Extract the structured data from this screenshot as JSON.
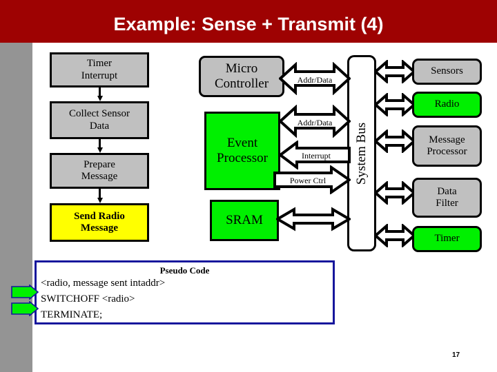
{
  "slide": {
    "title": "Example: Sense + Transmit (4)",
    "page_number": "17",
    "banner_color": "#9e0202",
    "side_strip_color": "#949494"
  },
  "flow": {
    "steps": [
      {
        "label": "Timer\nInterrupt",
        "fill": "#c0c0c0",
        "bold": false
      },
      {
        "label": "Collect Sensor\nData",
        "fill": "#c0c0c0",
        "bold": false
      },
      {
        "label": "Prepare\nMessage",
        "fill": "#c0c0c0",
        "bold": false
      },
      {
        "label": "Send Radio\nMessage",
        "fill": "#ffff00",
        "bold": true
      }
    ]
  },
  "middle": {
    "blocks": [
      {
        "label": "Micro\nController",
        "fill": "#c0c0c0"
      },
      {
        "label": "Event\nProcessor",
        "fill": "#00f000"
      },
      {
        "label": "SRAM",
        "fill": "#00f000"
      }
    ]
  },
  "bus": {
    "label": "System Bus",
    "fill": "#ffffff"
  },
  "bus_signals": [
    {
      "label": "Addr/Data",
      "direction": "both"
    },
    {
      "label": "Addr/Data",
      "direction": "both"
    },
    {
      "label": "Interrupt",
      "direction": "left"
    },
    {
      "label": "Power Ctrl",
      "direction": "right"
    }
  ],
  "peripherals": [
    {
      "label": "Sensors",
      "fill": "#c0c0c0"
    },
    {
      "label": "Radio",
      "fill": "#00f000"
    },
    {
      "label": "Message\nProcessor",
      "fill": "#c0c0c0"
    },
    {
      "label": "Data\nFilter",
      "fill": "#c0c0c0"
    },
    {
      "label": "Timer",
      "fill": "#00f000"
    }
  ],
  "pseudo_code": {
    "title": "Pseudo Code",
    "line1": "<radio, message sent intaddr>",
    "line2": "SWITCHOFF <radio>",
    "line3": "TERMINATE;",
    "border_color": "#16169c",
    "marker_fill": "#00f000"
  }
}
